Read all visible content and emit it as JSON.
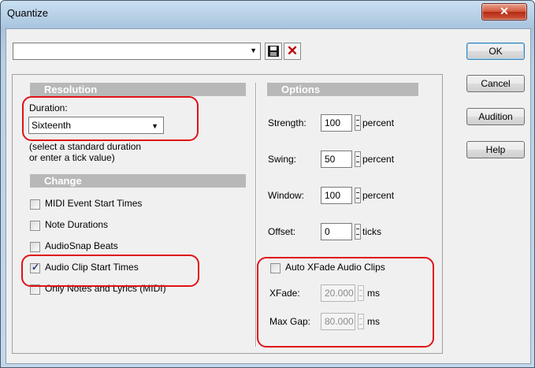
{
  "window": {
    "title": "Quantize",
    "close_glyph": "✕"
  },
  "preset": {
    "value": ""
  },
  "buttons": {
    "ok": "OK",
    "cancel": "Cancel",
    "audition": "Audition",
    "help": "Help"
  },
  "resolution": {
    "header": "Resolution",
    "duration_label": "Duration:",
    "duration_value": "Sixteenth",
    "hint_line1": "(select a standard duration",
    "hint_line2": "or enter a tick value)"
  },
  "change": {
    "header": "Change",
    "items": [
      {
        "label": "MIDI Event Start Times",
        "checked": false
      },
      {
        "label": "Note Durations",
        "checked": false
      },
      {
        "label": "AudioSnap Beats",
        "checked": false
      },
      {
        "label": "Audio Clip Start Times",
        "checked": true
      },
      {
        "label": "Only Notes and Lyrics (MIDI)",
        "checked": false
      }
    ]
  },
  "options": {
    "header": "Options",
    "strength": {
      "label": "Strength:",
      "value": "100",
      "unit": "percent"
    },
    "swing": {
      "label": "Swing:",
      "value": "50",
      "unit": "percent"
    },
    "window": {
      "label": "Window:",
      "value": "100",
      "unit": "percent"
    },
    "offset": {
      "label": "Offset:",
      "value": "0",
      "unit": "ticks"
    }
  },
  "xfade": {
    "auto_label": "Auto XFade Audio Clips",
    "auto_checked": false,
    "xfade_label": "XFade:",
    "xfade_value": "20.000",
    "xfade_unit": "ms",
    "maxgap_label": "Max Gap:",
    "maxgap_value": "80.000",
    "maxgap_unit": "ms"
  },
  "icons": {
    "save": "floppy-disk-icon",
    "delete": "red-x-icon",
    "dropdown": "chevron-down-icon"
  },
  "colors": {
    "highlight": "#e01218",
    "delete": "#c00000"
  }
}
